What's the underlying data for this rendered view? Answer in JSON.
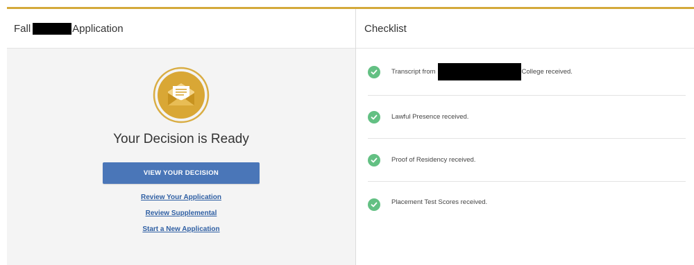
{
  "application": {
    "title_prefix": "Fall",
    "title_suffix": "Application"
  },
  "decision": {
    "title": "Your Decision is Ready",
    "view_button": "VIEW YOUR DECISION",
    "links": [
      "Review Your Application",
      "Review Supplemental",
      "Start a New Application"
    ]
  },
  "checklist": {
    "title": "Checklist",
    "items": [
      {
        "prefix": "Transcript from",
        "suffix": "College received."
      },
      {
        "text": "Lawful Presence received."
      },
      {
        "text": "Proof of Residency received."
      },
      {
        "text": "Placement Test Scores received."
      }
    ]
  },
  "colors": {
    "accent_bar": "#d4a93a",
    "button": "#4a76b8",
    "link": "#2f5fa3",
    "check": "#63c083"
  },
  "icons": {
    "decision": "envelope-letter-icon",
    "check": "checkmark-circle-icon"
  }
}
